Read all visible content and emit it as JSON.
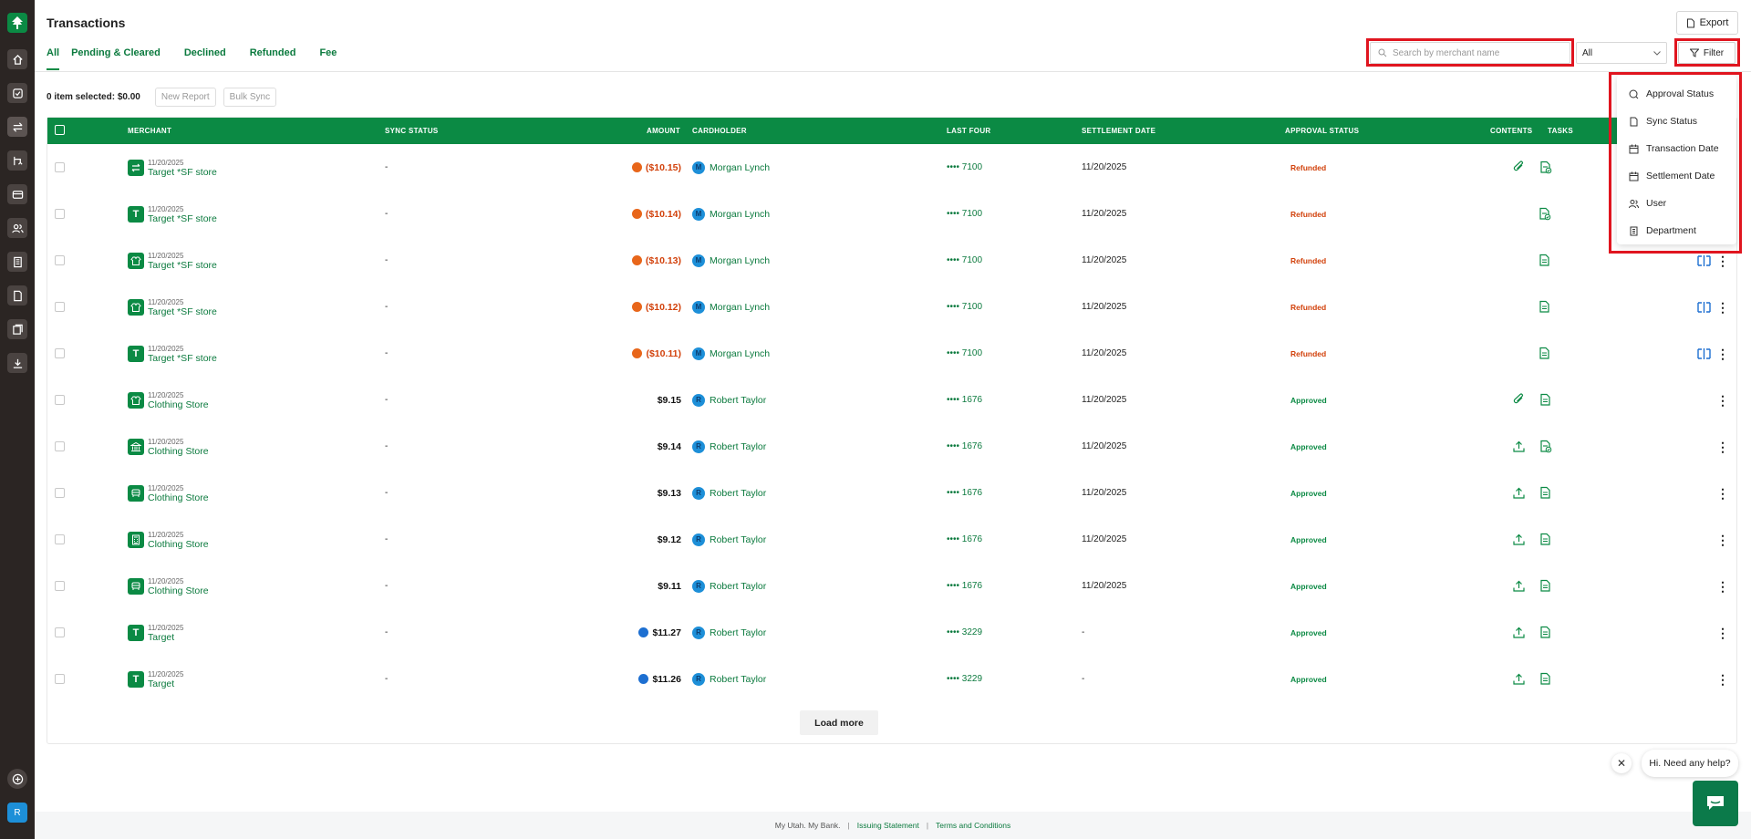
{
  "page": {
    "title": "Transactions"
  },
  "tabs": [
    {
      "label": "All",
      "active": true
    },
    {
      "label": "Pending & Cleared"
    },
    {
      "label": "Declined"
    },
    {
      "label": "Refunded"
    },
    {
      "label": "Fee"
    }
  ],
  "header": {
    "export_label": "Export",
    "filter_label": "Filter"
  },
  "search": {
    "placeholder": "Search by merchant name",
    "value": ""
  },
  "status_select": {
    "value": "All"
  },
  "selection": {
    "summary": "0 item selected: $0.00",
    "new_report": "New Report",
    "bulk_sync": "Bulk Sync"
  },
  "columns": {
    "merchant": "MERCHANT",
    "sync_status": "SYNC STATUS",
    "amount": "AMOUNT",
    "cardholder": "CARDHOLDER",
    "last_four": "LAST FOUR",
    "settlement_date": "SETTLEMENT DATE",
    "approval_status": "APPROVAL STATUS",
    "contents": "CONTENTS",
    "tasks": "TASKS"
  },
  "rows": [
    {
      "date": "11/20/2025",
      "merchant": "Target *SF store",
      "icon": "swap-icon",
      "sync": "-",
      "amount": "($10.15)",
      "amount_type": "refund",
      "initial": "M",
      "cardholder": "Morgan Lynch",
      "last4": "•••• 7100",
      "settlement": "11/20/2025",
      "status": "Refunded",
      "contents": [
        "paperclip-icon",
        "receipt-check-icon"
      ],
      "tasks": []
    },
    {
      "date": "11/20/2025",
      "merchant": "Target *SF store",
      "icon": "letter-t-icon",
      "sync": "-",
      "amount": "($10.14)",
      "amount_type": "refund",
      "initial": "M",
      "cardholder": "Morgan Lynch",
      "last4": "•••• 7100",
      "settlement": "11/20/2025",
      "status": "Refunded",
      "contents": [
        "receipt-check-icon"
      ],
      "tasks": []
    },
    {
      "date": "11/20/2025",
      "merchant": "Target *SF store",
      "icon": "shirt-icon",
      "sync": "-",
      "amount": "($10.13)",
      "amount_type": "refund",
      "initial": "M",
      "cardholder": "Morgan Lynch",
      "last4": "•••• 7100",
      "settlement": "11/20/2025",
      "status": "Refunded",
      "contents": [
        "receipt-icon"
      ],
      "tasks": [
        "split-icon",
        "kebab-icon"
      ]
    },
    {
      "date": "11/20/2025",
      "merchant": "Target *SF store",
      "icon": "shirt-icon",
      "sync": "-",
      "amount": "($10.12)",
      "amount_type": "refund",
      "initial": "M",
      "cardholder": "Morgan Lynch",
      "last4": "•••• 7100",
      "settlement": "11/20/2025",
      "status": "Refunded",
      "contents": [
        "receipt-icon"
      ],
      "tasks": [
        "split-icon",
        "kebab-icon"
      ]
    },
    {
      "date": "11/20/2025",
      "merchant": "Target *SF store",
      "icon": "letter-t-icon",
      "sync": "-",
      "amount": "($10.11)",
      "amount_type": "refund",
      "initial": "M",
      "cardholder": "Morgan Lynch",
      "last4": "•••• 7100",
      "settlement": "11/20/2025",
      "status": "Refunded",
      "contents": [
        "receipt-icon"
      ],
      "tasks": [
        "split-icon",
        "kebab-icon"
      ]
    },
    {
      "date": "11/20/2025",
      "merchant": "Clothing Store",
      "icon": "shirt-icon",
      "sync": "-",
      "amount": "$9.15",
      "amount_type": "normal",
      "initial": "R",
      "cardholder": "Robert Taylor",
      "last4": "•••• 1676",
      "settlement": "11/20/2025",
      "status": "Approved",
      "contents": [
        "paperclip-icon",
        "receipt-icon"
      ],
      "tasks": [
        "kebab-icon"
      ]
    },
    {
      "date": "11/20/2025",
      "merchant": "Clothing Store",
      "icon": "bank-icon",
      "sync": "-",
      "amount": "$9.14",
      "amount_type": "normal",
      "initial": "R",
      "cardholder": "Robert Taylor",
      "last4": "•••• 1676",
      "settlement": "11/20/2025",
      "status": "Approved",
      "contents": [
        "upload-icon",
        "receipt-check-icon"
      ],
      "tasks": [
        "kebab-icon"
      ]
    },
    {
      "date": "11/20/2025",
      "merchant": "Clothing Store",
      "icon": "car-icon",
      "sync": "-",
      "amount": "$9.13",
      "amount_type": "normal",
      "initial": "R",
      "cardholder": "Robert Taylor",
      "last4": "•••• 1676",
      "settlement": "11/20/2025",
      "status": "Approved",
      "contents": [
        "upload-icon",
        "receipt-icon"
      ],
      "tasks": [
        "kebab-icon"
      ]
    },
    {
      "date": "11/20/2025",
      "merchant": "Clothing Store",
      "icon": "calculator-icon",
      "sync": "-",
      "amount": "$9.12",
      "amount_type": "normal",
      "initial": "R",
      "cardholder": "Robert Taylor",
      "last4": "•••• 1676",
      "settlement": "11/20/2025",
      "status": "Approved",
      "contents": [
        "upload-icon",
        "receipt-icon"
      ],
      "tasks": [
        "kebab-icon"
      ]
    },
    {
      "date": "11/20/2025",
      "merchant": "Clothing Store",
      "icon": "car-icon",
      "sync": "-",
      "amount": "$9.11",
      "amount_type": "normal",
      "initial": "R",
      "cardholder": "Robert Taylor",
      "last4": "•••• 1676",
      "settlement": "11/20/2025",
      "status": "Approved",
      "contents": [
        "upload-icon",
        "receipt-icon"
      ],
      "tasks": [
        "kebab-icon"
      ]
    },
    {
      "date": "11/20/2025",
      "merchant": "Target",
      "icon": "letter-t-icon",
      "sync": "-",
      "amount": "$11.27",
      "amount_type": "pending",
      "initial": "R",
      "cardholder": "Robert Taylor",
      "last4": "•••• 3229",
      "settlement": "-",
      "status": "Approved",
      "contents": [
        "upload-icon",
        "receipt-icon"
      ],
      "tasks": [
        "kebab-icon"
      ]
    },
    {
      "date": "11/20/2025",
      "merchant": "Target",
      "icon": "letter-t-icon",
      "sync": "-",
      "amount": "$11.26",
      "amount_type": "pending",
      "initial": "R",
      "cardholder": "Robert Taylor",
      "last4": "•••• 3229",
      "settlement": "-",
      "status": "Approved",
      "contents": [
        "upload-icon",
        "receipt-icon"
      ],
      "tasks": [
        "kebab-icon"
      ]
    }
  ],
  "load_more": "Load more",
  "filter_menu": [
    {
      "label": "Approval Status",
      "icon": "approval-icon"
    },
    {
      "label": "Sync Status",
      "icon": "sync-file-icon"
    },
    {
      "label": "Transaction Date",
      "icon": "calendar-icon"
    },
    {
      "label": "Settlement Date",
      "icon": "calendar-alt-icon"
    },
    {
      "label": "User",
      "icon": "users-icon"
    },
    {
      "label": "Department",
      "icon": "building-icon"
    }
  ],
  "footer": {
    "tagline": "My Utah. My Bank.",
    "issuing": "Issuing Statement",
    "terms": "Terms and Conditions",
    "sep": "|"
  },
  "chat": {
    "greeting": "Hi. Need any help?",
    "close": "✕"
  },
  "sidebar": {
    "avatar": "R"
  },
  "colors": {
    "brand": "#0b8a44",
    "refunded": "#d2420c",
    "highlight": "#e0151f"
  }
}
